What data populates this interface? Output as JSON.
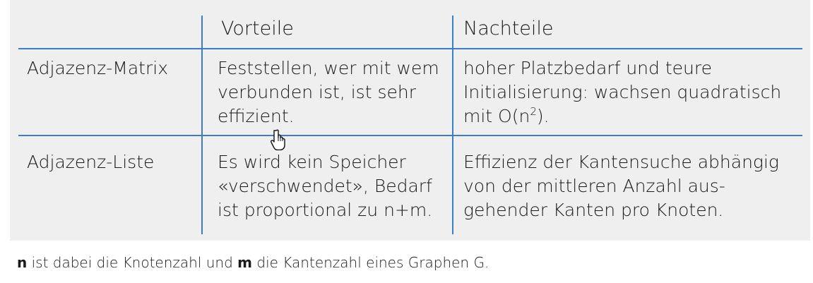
{
  "table": {
    "headers": [
      "",
      "Vorteile",
      "Nachteile"
    ],
    "rows": [
      {
        "label": "Adjazenz-Matrix",
        "vorteile": "Feststellen, wer mit wem\nverbunden ist, ist sehr\neffizient.",
        "nachteile_pre": "hoher Platzbedarf und teure\nInitialisierung: wachsen quadratisch\nmit O(n",
        "nachteile_sup": "2",
        "nachteile_post": ")."
      },
      {
        "label": "Adjazenz-Liste",
        "vorteile": "Es wird kein Speicher\n«verschwendet», Bedarf\nist proportional zu n+m.",
        "nachteile": "Effizienz der Kantensuche abhängig\nvon der mittleren Anzahl aus-\ngehender Kanten pro Knoten."
      }
    ]
  },
  "footnote": {
    "n": "n",
    "part1": " ist dabei die Knotenzahl und ",
    "m": "m",
    "part2": " die Kantenzahl eines Graphen G."
  },
  "colors": {
    "line": "#3a7dc9",
    "panel": "#efefef"
  },
  "icons": [
    "hand-cursor-icon"
  ]
}
